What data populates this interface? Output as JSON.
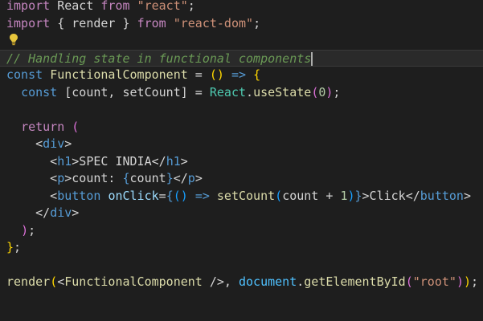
{
  "editor": {
    "lines": [
      {
        "tokens": [
          {
            "t": "import",
            "k": "keyword"
          },
          {
            "t": " React ",
            "k": "text"
          },
          {
            "t": "from",
            "k": "keyword"
          },
          {
            "t": " ",
            "k": "text"
          },
          {
            "t": "\"react\"",
            "k": "string"
          },
          {
            "t": ";",
            "k": "text"
          }
        ]
      },
      {
        "tokens": [
          {
            "t": "import",
            "k": "keyword"
          },
          {
            "t": " { render } ",
            "k": "text"
          },
          {
            "t": "from",
            "k": "keyword"
          },
          {
            "t": " ",
            "k": "text"
          },
          {
            "t": "\"react-dom\"",
            "k": "string"
          },
          {
            "t": ";",
            "k": "text"
          }
        ]
      },
      {
        "tokens": []
      },
      {
        "current": true,
        "cursor": true,
        "tokens": [
          {
            "t": "// Handling state in functional components",
            "k": "comment"
          }
        ]
      },
      {
        "tokens": [
          {
            "t": "const",
            "k": "storage"
          },
          {
            "t": " ",
            "k": "text"
          },
          {
            "t": "FunctionalComponent",
            "k": "function"
          },
          {
            "t": " = ",
            "k": "text"
          },
          {
            "t": "()",
            "k": "paren-0"
          },
          {
            "t": " ",
            "k": "text"
          },
          {
            "t": "=>",
            "k": "storage"
          },
          {
            "t": " ",
            "k": "text"
          },
          {
            "t": "{",
            "k": "paren-0"
          }
        ]
      },
      {
        "tokens": [
          {
            "t": "  ",
            "k": "text"
          },
          {
            "t": "const",
            "k": "storage"
          },
          {
            "t": " [count, setCount] = ",
            "k": "text"
          },
          {
            "t": "React",
            "k": "component"
          },
          {
            "t": ".",
            "k": "text"
          },
          {
            "t": "useState",
            "k": "function"
          },
          {
            "t": "(",
            "k": "paren-1"
          },
          {
            "t": "0",
            "k": "number"
          },
          {
            "t": ")",
            "k": "paren-1"
          },
          {
            "t": ";",
            "k": "text"
          }
        ]
      },
      {
        "tokens": []
      },
      {
        "tokens": [
          {
            "t": "  ",
            "k": "text"
          },
          {
            "t": "return",
            "k": "keyword"
          },
          {
            "t": " ",
            "k": "text"
          },
          {
            "t": "(",
            "k": "paren-1"
          }
        ]
      },
      {
        "tokens": [
          {
            "t": "    <",
            "k": "text"
          },
          {
            "t": "div",
            "k": "tag"
          },
          {
            "t": ">",
            "k": "text"
          }
        ]
      },
      {
        "tokens": [
          {
            "t": "      <",
            "k": "text"
          },
          {
            "t": "h1",
            "k": "tag"
          },
          {
            "t": ">SPEC INDIA</",
            "k": "text"
          },
          {
            "t": "h1",
            "k": "tag"
          },
          {
            "t": ">",
            "k": "text"
          }
        ]
      },
      {
        "tokens": [
          {
            "t": "      <",
            "k": "text"
          },
          {
            "t": "p",
            "k": "tag"
          },
          {
            "t": ">count: ",
            "k": "text"
          },
          {
            "t": "{",
            "k": "storage"
          },
          {
            "t": "count",
            "k": "text"
          },
          {
            "t": "}",
            "k": "storage"
          },
          {
            "t": "</",
            "k": "text"
          },
          {
            "t": "p",
            "k": "tag"
          },
          {
            "t": ">",
            "k": "text"
          }
        ]
      },
      {
        "tokens": [
          {
            "t": "      <",
            "k": "text"
          },
          {
            "t": "button",
            "k": "tag"
          },
          {
            "t": " ",
            "k": "text"
          },
          {
            "t": "onClick",
            "k": "attr"
          },
          {
            "t": "=",
            "k": "text"
          },
          {
            "t": "{",
            "k": "storage"
          },
          {
            "t": "()",
            "k": "paren-2"
          },
          {
            "t": " ",
            "k": "text"
          },
          {
            "t": "=>",
            "k": "storage"
          },
          {
            "t": " ",
            "k": "text"
          },
          {
            "t": "setCount",
            "k": "function"
          },
          {
            "t": "(",
            "k": "paren-2"
          },
          {
            "t": "count + ",
            "k": "text"
          },
          {
            "t": "1",
            "k": "number"
          },
          {
            "t": ")",
            "k": "paren-2"
          },
          {
            "t": "}",
            "k": "storage"
          },
          {
            "t": ">Click</",
            "k": "text"
          },
          {
            "t": "button",
            "k": "tag"
          },
          {
            "t": ">",
            "k": "text"
          }
        ]
      },
      {
        "tokens": [
          {
            "t": "    </",
            "k": "text"
          },
          {
            "t": "div",
            "k": "tag"
          },
          {
            "t": ">",
            "k": "text"
          }
        ]
      },
      {
        "tokens": [
          {
            "t": "  ",
            "k": "text"
          },
          {
            "t": ")",
            "k": "paren-1"
          },
          {
            "t": ";",
            "k": "text"
          }
        ]
      },
      {
        "tokens": [
          {
            "t": "}",
            "k": "paren-0"
          },
          {
            "t": ";",
            "k": "text"
          }
        ]
      },
      {
        "tokens": []
      },
      {
        "tokens": [
          {
            "t": "render",
            "k": "function"
          },
          {
            "t": "(",
            "k": "paren-0"
          },
          {
            "t": "<",
            "k": "text"
          },
          {
            "t": "FunctionalComponent",
            "k": "function"
          },
          {
            "t": " />, ",
            "k": "text"
          },
          {
            "t": "document",
            "k": "var"
          },
          {
            "t": ".",
            "k": "text"
          },
          {
            "t": "getElementById",
            "k": "function"
          },
          {
            "t": "(",
            "k": "paren-1"
          },
          {
            "t": "\"root\"",
            "k": "string"
          },
          {
            "t": ")",
            "k": "paren-1"
          },
          {
            "t": ")",
            "k": "paren-0"
          },
          {
            "t": ";",
            "k": "text"
          }
        ]
      }
    ]
  },
  "lightbulb": {
    "icon": "lightbulb-icon",
    "color": "#e8c63c"
  },
  "colors": {
    "background": "#1e1e1e",
    "current_line": "#2a2a2a",
    "keyword": "#c586c0",
    "string": "#ce9178",
    "comment": "#6a9955"
  }
}
